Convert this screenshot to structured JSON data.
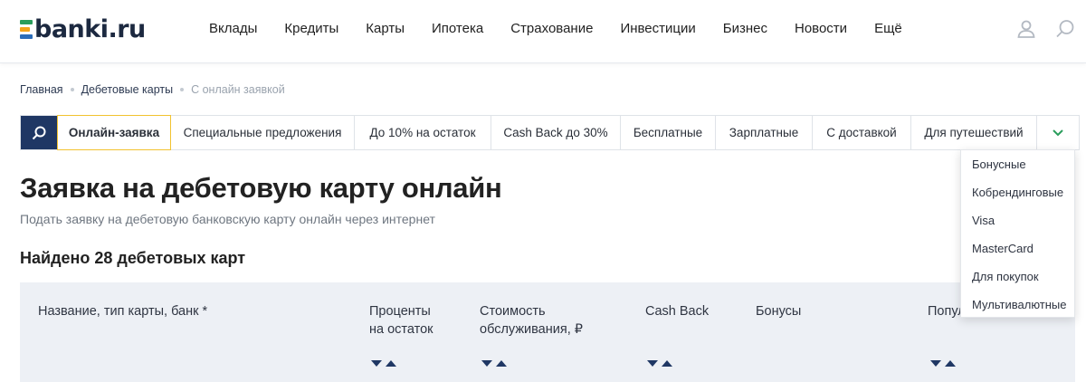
{
  "header": {
    "logo_text": "banki.ru",
    "nav": [
      "Вклады",
      "Кредиты",
      "Карты",
      "Ипотека",
      "Страхование",
      "Инвестиции",
      "Бизнес",
      "Новости",
      "Ещё"
    ]
  },
  "breadcrumb": {
    "items": [
      "Главная",
      "Дебетовые карты",
      "С онлайн заявкой"
    ]
  },
  "filters": {
    "tabs": [
      "Онлайн-заявка",
      "Специальные предложения",
      "До 10% на остаток",
      "Cash Back до 30%",
      "Бесплатные",
      "Зарплатные",
      "С доставкой",
      "Для путешествий"
    ],
    "active_tab": "Онлайн-заявка",
    "more_items": [
      "Бонусные",
      "Кобрендинговые",
      "Visa",
      "MasterCard",
      "Для покупок",
      "Мультивалютные"
    ]
  },
  "page": {
    "title": "Заявка на дебетовую карту онлайн",
    "subtitle": "Подать заявку на дебетовую банковскую карту онлайн через интернет",
    "found": "Найдено 28 дебетовых карт"
  },
  "table": {
    "columns": [
      "Название, тип карты, банк *",
      "Проценты\nна остаток",
      "Стоимость\nобслуживания, ₽",
      "Cash Back",
      "Бонусы",
      "Популярность"
    ]
  },
  "colors": {
    "brand_navy": "#1f3764",
    "accent_yellow": "#f2c230",
    "logo_green": "#2a9d5c",
    "logo_orange": "#f2a31b",
    "logo_blue": "#2b6cb8"
  }
}
